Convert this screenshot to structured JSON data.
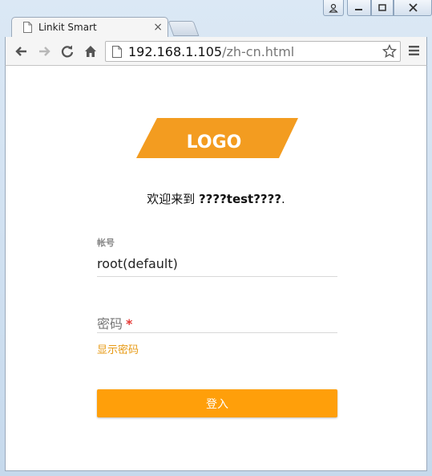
{
  "browser": {
    "tab_title": "Linkit Smart",
    "tab_close": "×",
    "url_host": "192.168.1.105",
    "url_path": "/zh-cn.html"
  },
  "page": {
    "logo_text": "LOGO",
    "welcome_prefix": "欢迎来到 ",
    "welcome_name": "????test????",
    "welcome_suffix": ".",
    "account_label": "帐号",
    "account_value": "root(default)",
    "password_placeholder": "密码",
    "password_required": "*",
    "show_password": "显示密码",
    "login_button": "登入"
  },
  "colors": {
    "accent": "#ff9f0a",
    "logo": "#f39c20",
    "link": "#e79a14"
  }
}
